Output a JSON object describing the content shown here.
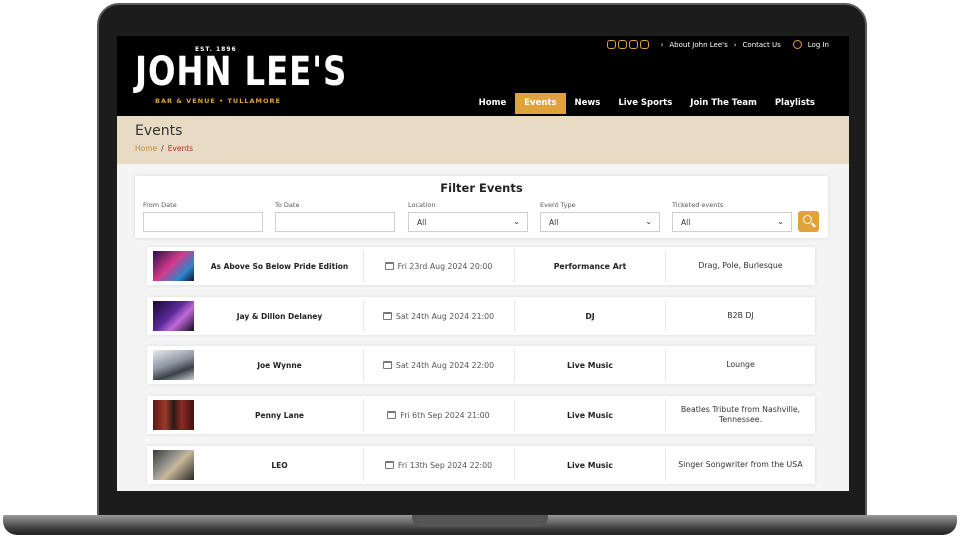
{
  "header": {
    "logo": {
      "est": "EST. 1896",
      "name": "JOHN LEE'S",
      "sub": "BAR & VENUE  •  TULLAMORE"
    },
    "top_links": {
      "about": "About John Lee's",
      "contact": "Contact Us",
      "login": "Log In"
    },
    "social_icons": [
      "instagram-icon",
      "tiktok-icon",
      "facebook-icon",
      "x-icon"
    ],
    "nav": [
      "Home",
      "Events",
      "News",
      "Live Sports",
      "Join The Team",
      "Playlists"
    ],
    "active_nav": "Events"
  },
  "page": {
    "title": "Events",
    "breadcrumb": {
      "home": "Home",
      "sep": "/",
      "current": "Events"
    }
  },
  "filter": {
    "title": "Filter Events",
    "fields": [
      {
        "label": "From Date",
        "value": ""
      },
      {
        "label": "To Date",
        "value": ""
      },
      {
        "label": "Location",
        "value": "All"
      },
      {
        "label": "Event Type",
        "value": "All"
      },
      {
        "label": "Ticketed events",
        "value": "All"
      }
    ]
  },
  "events": [
    {
      "name": "As Above So Below Pride Edition",
      "date": "Fri 23rd Aug 2024 20:00",
      "type": "Performance Art",
      "desc": "Drag, Pole, Burlesque"
    },
    {
      "name": "Jay & Dillon Delaney",
      "date": "Sat 24th Aug 2024 21:00",
      "type": "DJ",
      "desc": "B2B DJ"
    },
    {
      "name": "Joe Wynne",
      "date": "Sat 24th Aug 2024 22:00",
      "type": "Live Music",
      "desc": "Lounge"
    },
    {
      "name": "Penny Lane",
      "date": "Fri 6th Sep 2024 21:00",
      "type": "Live Music",
      "desc": "Beatles Tribute from Nashville, Tennessee."
    },
    {
      "name": "LEO",
      "date": "Fri 13th Sep 2024 22:00",
      "type": "Live Music",
      "desc": "Singer Songwriter from the USA"
    }
  ],
  "colors": {
    "accent": "#e0a23a",
    "band": "#e8dbc4",
    "crumb_current": "#b22a2a"
  }
}
